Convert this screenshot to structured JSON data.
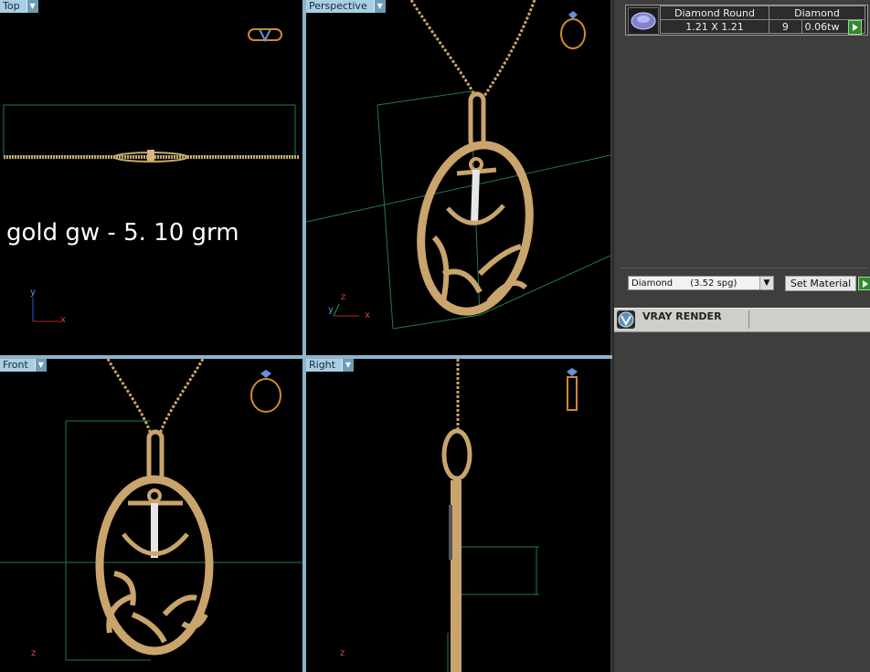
{
  "viewports": {
    "top": {
      "label": "Top"
    },
    "perspective": {
      "label": "Perspective"
    },
    "front": {
      "label": "Front"
    },
    "right": {
      "label": "Right"
    }
  },
  "weight_note": "gold gw - 5. 10 grm",
  "axes": {
    "x": "x",
    "y": "y",
    "z": "z"
  },
  "stone_table": {
    "shape_header": "Diamond Round",
    "size": "1.21 X 1.21",
    "type_header": "Diamond",
    "count": "9",
    "weight": "0.06tw"
  },
  "material": {
    "selected": "Diamond      (3.52 spg)",
    "set_button": "Set Material"
  },
  "vray": {
    "title": "VRAY RENDER"
  },
  "colors": {
    "gold": "#c9a46c",
    "guide": "#1f7a4f",
    "tab": "#a9cfe4"
  }
}
